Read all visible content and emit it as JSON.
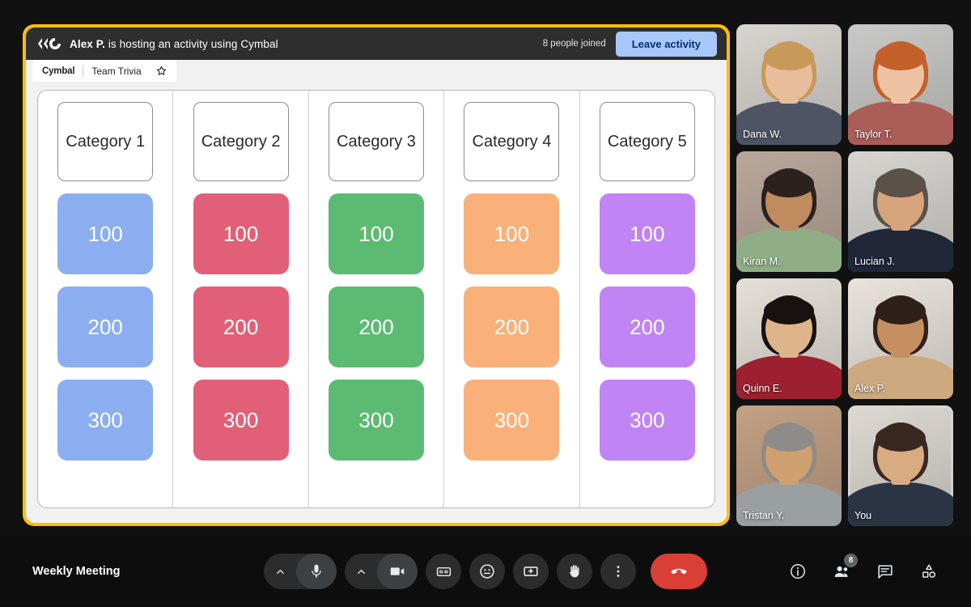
{
  "activity": {
    "logo_name": "cymbal-logo",
    "title_name": "Alex P.",
    "title_rest": " is hosting an activity using Cymbal",
    "people_joined": "8 people joined",
    "leave_label": "Leave activity",
    "tab": {
      "brand": "Cymbal",
      "doc_name": "Team Trivia",
      "star_icon": "star-icon"
    }
  },
  "board": {
    "columns": [
      {
        "category": "Category 1",
        "color": "#8aaef0",
        "tiles": [
          "100",
          "200",
          "300"
        ]
      },
      {
        "category": "Category 2",
        "color": "#e16078",
        "tiles": [
          "100",
          "200",
          "300"
        ]
      },
      {
        "category": "Category 3",
        "color": "#5cbb72",
        "tiles": [
          "100",
          "200",
          "300"
        ]
      },
      {
        "category": "Category 4",
        "color": "#f9b179",
        "tiles": [
          "100",
          "200",
          "300"
        ]
      },
      {
        "category": "Category 5",
        "color": "#c184f5",
        "tiles": [
          "100",
          "200",
          "300"
        ]
      }
    ]
  },
  "participants": [
    {
      "name": "Dana W.",
      "self": false,
      "bg": "#d8d4cf",
      "skin": "#e8bd9c",
      "hair": "#c79a5b",
      "shirt": "#4e5463"
    },
    {
      "name": "Taylor T.",
      "self": false,
      "bg": "#c9c9c7",
      "skin": "#edc3a4",
      "hair": "#c4602a",
      "shirt": "#ab5d57"
    },
    {
      "name": "Kiran M.",
      "self": false,
      "bg": "#b9a79a",
      "skin": "#c08b5f",
      "hair": "#2b2220",
      "shirt": "#8fae86"
    },
    {
      "name": "Lucian J.",
      "self": false,
      "bg": "#d7d5d0",
      "skin": "#d6a57c",
      "hair": "#5a5149",
      "shirt": "#1f2738"
    },
    {
      "name": "Quinn E.",
      "self": false,
      "bg": "#e4e0d8",
      "skin": "#e0b48b",
      "hair": "#17120f",
      "shirt": "#9c2030"
    },
    {
      "name": "Alex P.",
      "self": false,
      "bg": "#e9e3dc",
      "skin": "#c58f62",
      "hair": "#30201a",
      "shirt": "#cda980"
    },
    {
      "name": "Tristan Y.",
      "self": false,
      "bg": "#c2a184",
      "skin": "#d1a070",
      "hair": "#8e8b88",
      "shirt": "#9aa0a2"
    },
    {
      "name": "You",
      "self": true,
      "bg": "#ddd9d2",
      "skin": "#d8ab80",
      "hair": "#3a2820",
      "shirt": "#2b3445"
    }
  ],
  "bottom_bar": {
    "meeting_name": "Weekly Meeting",
    "controls": [
      {
        "name": "microphone-button",
        "icon": "microphone-icon",
        "chevron": "chevron-up-icon"
      },
      {
        "name": "camera-button",
        "icon": "camera-icon",
        "chevron": "chevron-up-icon"
      },
      {
        "name": "captions-button",
        "icon": "closed-captions-icon"
      },
      {
        "name": "reactions-button",
        "icon": "emoji-icon"
      },
      {
        "name": "present-button",
        "icon": "present-screen-icon"
      },
      {
        "name": "raise-hand-button",
        "icon": "raise-hand-icon"
      },
      {
        "name": "more-options-button",
        "icon": "more-vertical-icon"
      },
      {
        "name": "end-call-button",
        "icon": "phone-hangup-icon"
      }
    ],
    "right_controls": [
      {
        "name": "meeting-details-button",
        "icon": "info-icon"
      },
      {
        "name": "people-button",
        "icon": "people-icon",
        "badge": "8"
      },
      {
        "name": "chat-button",
        "icon": "chat-icon"
      },
      {
        "name": "activities-button",
        "icon": "activities-icon"
      }
    ]
  },
  "colors": {
    "frame_yellow": "#fdbe0b",
    "accent_blue": "#a8c7fa",
    "end_call_red": "#d93f34"
  }
}
